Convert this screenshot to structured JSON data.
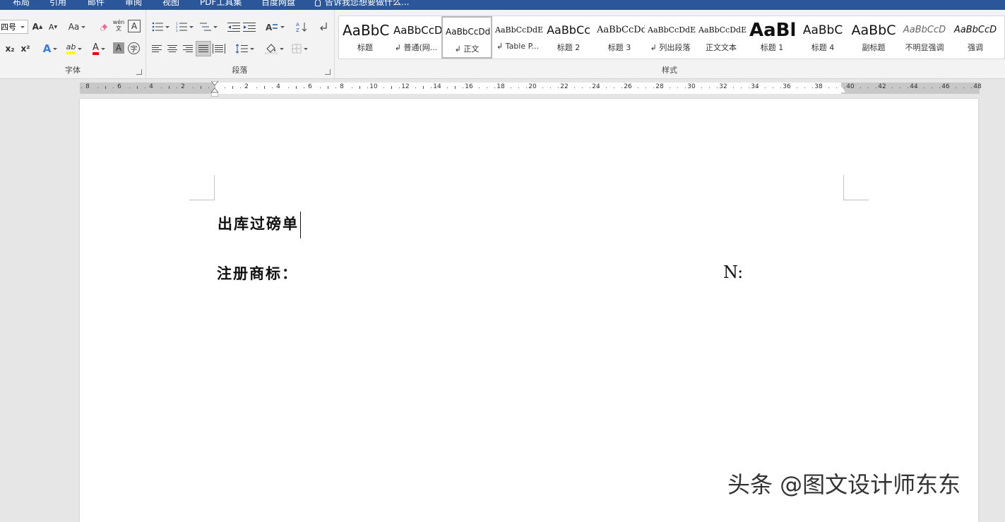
{
  "tabs": [
    "布局",
    "引用",
    "邮件",
    "审阅",
    "视图",
    "PDF工具集",
    "百度网盘"
  ],
  "tell_me": "告诉我您想要做什么...",
  "font_group": {
    "label": "字体",
    "font_size": "四号",
    "change_case": "Aa",
    "phonetic_glyph": "wén\n文",
    "border_glyph": "A",
    "grow_font": "A",
    "shrink_font": "A",
    "subscript": "x₂",
    "superscript": "x²",
    "text_effects": "A",
    "highlight": "ab",
    "font_color": "A",
    "shading": "A",
    "enclose": "字"
  },
  "paragraph_group": {
    "label": "段落"
  },
  "styles_group": {
    "label": "样式",
    "items": [
      {
        "preview": "AaBbC",
        "name": "标题"
      },
      {
        "preview": "AaBbCcD",
        "name": "↲ 普通(网..."
      },
      {
        "preview": "AaBbCcDd",
        "name": "↲ 正文"
      },
      {
        "preview": "AaBbCcDdE",
        "name": "↲ Table P..."
      },
      {
        "preview": "AaBbCc",
        "name": "标题 2"
      },
      {
        "preview": "AaBbCcDd",
        "name": "标题 3"
      },
      {
        "preview": "AaBbCcDdE",
        "name": "↲ 列出段落"
      },
      {
        "preview": "AaBbCcDdE",
        "name": "正文文本"
      },
      {
        "preview": "AaBl",
        "name": "标题 1"
      },
      {
        "preview": "AaBbC",
        "name": "标题 4"
      },
      {
        "preview": "AaBbC",
        "name": "副标题"
      },
      {
        "preview": "AaBbCcD",
        "name": "不明显强调"
      },
      {
        "preview": "AaBbCcD",
        "name": "强调"
      }
    ]
  },
  "ruler": {
    "left_numbers": [
      "8",
      "6",
      "4",
      "2"
    ],
    "right_numbers": [
      "2",
      "4",
      "6",
      "8",
      "10",
      "12",
      "14",
      "16",
      "18",
      "20",
      "22",
      "24",
      "26",
      "28",
      "30",
      "32",
      "34",
      "36",
      "38",
      "40",
      "42",
      "44",
      "46",
      "48"
    ]
  },
  "document": {
    "line1": "出库过磅单",
    "line2": "注册商标：",
    "n_label": "N:"
  },
  "watermark": "头条 @图文设计师东东"
}
